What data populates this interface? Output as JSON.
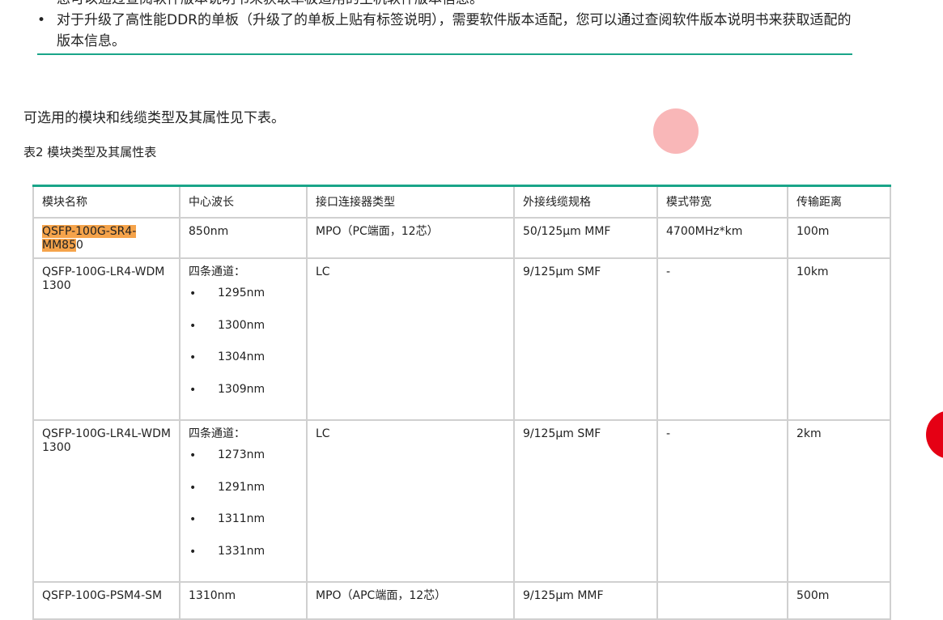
{
  "notes": [
    "您可以通过查阅软件版本说明书来获取单板适用的主机软件版本信息。",
    "对于升级了高性能DDR的单板（升级了的单板上贴有标签说明），需要软件版本适配，您可以通过查阅软件版本说明书来获取适配的版本信息。"
  ],
  "intro": "可选用的模块和线缆类型及其属性见下表。",
  "caption": "表2 模块类型及其属性表",
  "table": {
    "headers": [
      "模块名称",
      "中心波长",
      "接口连接器类型",
      "外接线缆规格",
      "模式带宽",
      "传输距离"
    ],
    "rows": [
      {
        "name_hl": "QSFP-100G-SR4-MM85",
        "name_rest": "0",
        "wavelength": "850nm",
        "connector": "MPO（PC端面，12芯）",
        "cable": "50/125µm MMF",
        "bandwidth": "4700MHz*km",
        "distance": "100m"
      },
      {
        "name": "QSFP-100G-LR4-WDM1300",
        "wavelength_title": "四条通道：",
        "wavelengths": [
          "1295nm",
          "1300nm",
          "1304nm",
          "1309nm"
        ],
        "connector": "LC",
        "cable": "9/125µm SMF",
        "bandwidth": "-",
        "distance": "10km"
      },
      {
        "name": "QSFP-100G-LR4L-WDM1300",
        "wavelength_title": "四条通道：",
        "wavelengths": [
          "1273nm",
          "1291nm",
          "1311nm",
          "1331nm"
        ],
        "connector": "LC",
        "cable": "9/125µm SMF",
        "bandwidth": "-",
        "distance": "2km"
      },
      {
        "name": "QSFP-100G-PSM4-SM",
        "wavelength": "1310nm",
        "connector": "MPO（APC端面，12芯）",
        "cable": "9/125µm MMF",
        "bandwidth": "",
        "distance": "500m"
      }
    ]
  },
  "colors": {
    "accent": "#1aa589",
    "highlight": "#f5a34a",
    "pink_dot": "#f9b7b8",
    "red_dot": "#e50014"
  }
}
